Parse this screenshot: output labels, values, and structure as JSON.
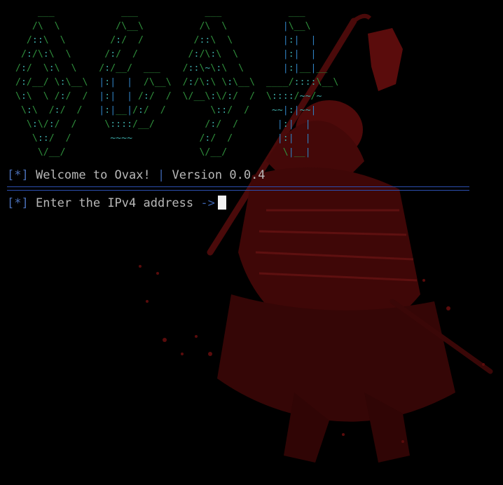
{
  "banner": {
    "lines": [
      "    ___            ___            ___            ___",
      "   /\\  \\          /\\__\\          /\\  \\          |\\__\\",
      "  /::\\  \\        /:/  /         /::\\  \\         |:|  |",
      " /:/\\:\\  \\      /:/  /         /:/\\:\\  \\        |:|  |",
      "/:/  \\:\\  \\    /:/__/  ___    /::\\~\\:\\  \\       |:|__|__",
      "/:/__/ \\:\\__\\  |:|  |  /\\__\\  /:/\\:\\ \\:\\__\\  ____/::::\\__\\",
      "\\:\\  \\ /:/  /  |:|  | /:/  /  \\/__\\:\\/:/  /  \\::::/~~/~",
      " \\:\\  /:/  /   |:|__|/:/  /        \\::/  /    ~~|:|~~|",
      "  \\:\\/:/  /     \\::::/__/         /:/  /       |:|  |",
      "   \\::/  /       ~~~~            /:/  /        |:|  |",
      "    \\/__/                        \\/__/          \\|__|"
    ]
  },
  "welcome": {
    "prefix": "[*]",
    "message": "Welcome to Ovax!",
    "separator": "|",
    "version": "Version 0.0.4"
  },
  "divider": "================================================================================",
  "prompt": {
    "prefix": "[*]",
    "label": "Enter the IPv4 address",
    "arrow": "->",
    "input_value": ""
  },
  "colors": {
    "background": "#000000",
    "text": "#b8b8b8",
    "accent_blue": "#4a6fb8",
    "banner_green": "#2f8f3c",
    "banner_teal": "#3aa3a0",
    "art_red": "#5a0c0c",
    "cursor": "#f2f2f2"
  }
}
